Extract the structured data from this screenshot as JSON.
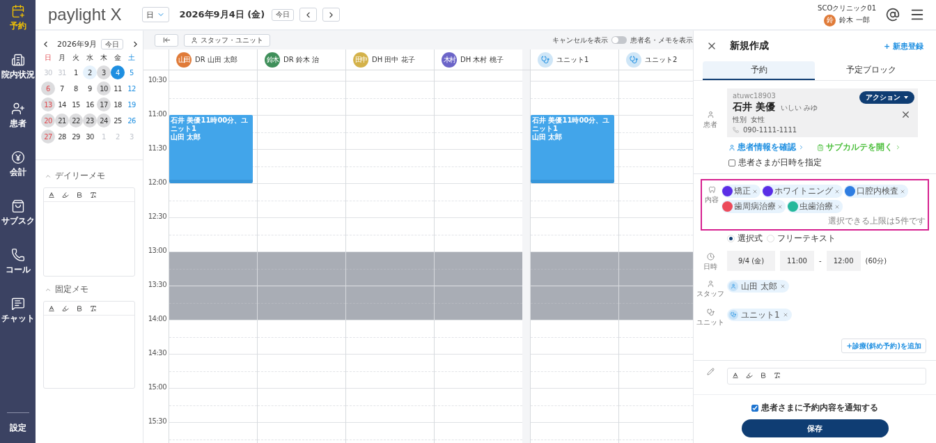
{
  "nav": {
    "items": [
      {
        "label": "予約",
        "selected": true
      },
      {
        "label": "院内状況",
        "selected": false
      },
      {
        "label": "患者",
        "selected": false
      },
      {
        "label": "会計",
        "selected": false
      },
      {
        "label": "サブスク",
        "selected": false
      },
      {
        "label": "コール",
        "selected": false
      },
      {
        "label": "チャット",
        "selected": false
      }
    ],
    "settings": "設定"
  },
  "header": {
    "logo": "paylight X",
    "view_select": "日",
    "date": "2026年9月4日 (金)",
    "today_button": "今日",
    "clinic": "SCOクリニック01",
    "user_initial": "鈴",
    "user_name": "鈴木 一郎"
  },
  "mini_calendar": {
    "title": "2026年9月",
    "today_button": "今日",
    "weekdays": [
      "日",
      "月",
      "火",
      "水",
      "木",
      "金",
      "土"
    ],
    "days": [
      {
        "label": "30",
        "muted": true,
        "marked": false,
        "today": false,
        "selected": false
      },
      {
        "label": "31",
        "muted": true,
        "marked": false,
        "today": false,
        "selected": false
      },
      {
        "label": "1",
        "muted": false,
        "marked": false,
        "today": false,
        "selected": false
      },
      {
        "label": "2",
        "muted": false,
        "marked": false,
        "today": true,
        "selected": false
      },
      {
        "label": "3",
        "muted": false,
        "marked": true,
        "today": false,
        "selected": false
      },
      {
        "label": "4",
        "muted": false,
        "marked": false,
        "today": false,
        "selected": true
      },
      {
        "label": "5",
        "muted": false,
        "marked": false,
        "today": false,
        "selected": false
      },
      {
        "label": "6",
        "muted": false,
        "marked": true,
        "today": false,
        "selected": false
      },
      {
        "label": "7",
        "muted": false,
        "marked": false,
        "today": false,
        "selected": false
      },
      {
        "label": "8",
        "muted": false,
        "marked": false,
        "today": false,
        "selected": false
      },
      {
        "label": "9",
        "muted": false,
        "marked": false,
        "today": false,
        "selected": false
      },
      {
        "label": "10",
        "muted": false,
        "marked": true,
        "today": false,
        "selected": false
      },
      {
        "label": "11",
        "muted": false,
        "marked": false,
        "today": false,
        "selected": false
      },
      {
        "label": "12",
        "muted": false,
        "marked": false,
        "today": false,
        "selected": false
      },
      {
        "label": "13",
        "muted": false,
        "marked": true,
        "today": false,
        "selected": false
      },
      {
        "label": "14",
        "muted": false,
        "marked": false,
        "today": false,
        "selected": false
      },
      {
        "label": "15",
        "muted": false,
        "marked": false,
        "today": false,
        "selected": false
      },
      {
        "label": "16",
        "muted": false,
        "marked": false,
        "today": false,
        "selected": false
      },
      {
        "label": "17",
        "muted": false,
        "marked": true,
        "today": false,
        "selected": false
      },
      {
        "label": "18",
        "muted": false,
        "marked": false,
        "today": false,
        "selected": false
      },
      {
        "label": "19",
        "muted": false,
        "marked": false,
        "today": false,
        "selected": false
      },
      {
        "label": "20",
        "muted": false,
        "marked": true,
        "today": false,
        "selected": false
      },
      {
        "label": "21",
        "muted": false,
        "marked": true,
        "today": false,
        "selected": false
      },
      {
        "label": "22",
        "muted": false,
        "marked": true,
        "today": false,
        "selected": false
      },
      {
        "label": "23",
        "muted": false,
        "marked": true,
        "today": false,
        "selected": false
      },
      {
        "label": "24",
        "muted": false,
        "marked": true,
        "today": false,
        "selected": false
      },
      {
        "label": "25",
        "muted": false,
        "marked": false,
        "today": false,
        "selected": false
      },
      {
        "label": "26",
        "muted": false,
        "marked": false,
        "today": false,
        "selected": false
      },
      {
        "label": "27",
        "muted": false,
        "marked": true,
        "today": false,
        "selected": false
      },
      {
        "label": "28",
        "muted": false,
        "marked": false,
        "today": false,
        "selected": false
      },
      {
        "label": "29",
        "muted": false,
        "marked": false,
        "today": false,
        "selected": false
      },
      {
        "label": "30",
        "muted": false,
        "marked": false,
        "today": false,
        "selected": false
      },
      {
        "label": "1",
        "muted": true,
        "marked": false,
        "today": false,
        "selected": false
      },
      {
        "label": "2",
        "muted": true,
        "marked": false,
        "today": false,
        "selected": false
      },
      {
        "label": "3",
        "muted": true,
        "marked": false,
        "today": false,
        "selected": false
      }
    ]
  },
  "memos": [
    {
      "title": "デイリーメモ",
      "expanded": true
    },
    {
      "title": "固定メモ",
      "expanded": true
    }
  ],
  "toolbar": {
    "staff_unit_button": "スタッフ・ユニット",
    "cancel_toggle": {
      "label": "キャンセルを表示",
      "on": false
    },
    "show_names_label": "患者名・メモを表示"
  },
  "calendar": {
    "columns": [
      {
        "kind": "staff",
        "name": "DR 山田 太郎",
        "initials": "山田",
        "color": "#e07b39"
      },
      {
        "kind": "staff",
        "name": "DR 鈴木 治",
        "initials": "鈴木",
        "color": "#3f8f5a"
      },
      {
        "kind": "staff",
        "name": "DH 田中 花子",
        "initials": "田中",
        "color": "#d4b24a"
      },
      {
        "kind": "staff",
        "name": "DH 木村 桃子",
        "initials": "木村",
        "color": "#6b64c8"
      },
      {
        "kind": "unit",
        "name": "ユニット1",
        "color": "#cfe6f7"
      },
      {
        "kind": "unit",
        "name": "ユニット2",
        "color": "#cfe6f7"
      }
    ],
    "rows": [
      {
        "time": "10:30",
        "cells": [
          {
            "kind": "free"
          },
          {
            "kind": "free"
          },
          {
            "kind": "free"
          },
          {
            "kind": "free"
          },
          {
            "kind": "free"
          },
          {
            "kind": "free"
          }
        ]
      },
      {
        "time": "11:00",
        "cells": [
          {
            "kind": "booked",
            "title": "石井 美優11時00分、ユニット1",
            "staff": "山田 太郎"
          },
          {
            "kind": "free"
          },
          {
            "kind": "free"
          },
          {
            "kind": "free"
          },
          {
            "kind": "booked",
            "title": "石井 美優11時00分、ユニット1",
            "staff": "山田 太郎"
          },
          {
            "kind": "free"
          }
        ]
      },
      {
        "time": "11:30",
        "cells": [
          {
            "kind": "booked"
          },
          {
            "kind": "free"
          },
          {
            "kind": "free"
          },
          {
            "kind": "free"
          },
          {
            "kind": "booked"
          },
          {
            "kind": "free"
          }
        ]
      },
      {
        "time": "12:00",
        "cells": [
          {
            "kind": "free"
          },
          {
            "kind": "free"
          },
          {
            "kind": "free"
          },
          {
            "kind": "free"
          },
          {
            "kind": "free"
          },
          {
            "kind": "free"
          }
        ]
      },
      {
        "time": "12:30",
        "cells": [
          {
            "kind": "free"
          },
          {
            "kind": "free"
          },
          {
            "kind": "free"
          },
          {
            "kind": "free"
          },
          {
            "kind": "free"
          },
          {
            "kind": "free"
          }
        ]
      },
      {
        "time": "13:00",
        "cells": [
          {
            "kind": "blocked"
          },
          {
            "kind": "blocked"
          },
          {
            "kind": "blocked"
          },
          {
            "kind": "blocked"
          },
          {
            "kind": "blocked"
          },
          {
            "kind": "blocked"
          }
        ]
      },
      {
        "time": "13:30",
        "cells": [
          {
            "kind": "blocked"
          },
          {
            "kind": "blocked"
          },
          {
            "kind": "blocked"
          },
          {
            "kind": "blocked"
          },
          {
            "kind": "blocked"
          },
          {
            "kind": "blocked"
          }
        ]
      },
      {
        "time": "14:00",
        "cells": [
          {
            "kind": "free"
          },
          {
            "kind": "free"
          },
          {
            "kind": "free"
          },
          {
            "kind": "free"
          },
          {
            "kind": "free"
          },
          {
            "kind": "free"
          }
        ]
      },
      {
        "time": "14:30",
        "cells": [
          {
            "kind": "free"
          },
          {
            "kind": "free"
          },
          {
            "kind": "free"
          },
          {
            "kind": "free"
          },
          {
            "kind": "free"
          },
          {
            "kind": "free"
          }
        ]
      },
      {
        "time": "15:00",
        "cells": [
          {
            "kind": "free"
          },
          {
            "kind": "free"
          },
          {
            "kind": "free"
          },
          {
            "kind": "free"
          },
          {
            "kind": "free"
          },
          {
            "kind": "free"
          }
        ]
      },
      {
        "time": "15:30",
        "cells": [
          {
            "kind": "free"
          },
          {
            "kind": "free"
          },
          {
            "kind": "free"
          },
          {
            "kind": "free"
          },
          {
            "kind": "free"
          },
          {
            "kind": "free"
          }
        ]
      }
    ]
  },
  "panel": {
    "title": "新規作成",
    "new_patient_link": "+ 新患登録",
    "tabs": [
      {
        "label": "予約",
        "selected": true
      },
      {
        "label": "予定ブロック",
        "selected": false
      }
    ],
    "patient": {
      "label": "患者",
      "id": "atuwc18903",
      "name": "石井 美優",
      "kana": "いしい みゆ",
      "gender_label": "性別",
      "gender": "女性",
      "phone": "090-1111-1111",
      "action_button": "アクション"
    },
    "links": [
      "患者情報を確認",
      "サブカルテを開く"
    ],
    "patient_sets_time": {
      "label": "患者さまが日時を指定",
      "checked": false
    },
    "content": {
      "label": "内容",
      "highlighted": true,
      "tags": [
        {
          "label": "矯正",
          "color": "#5a2ee6"
        },
        {
          "label": "ホワイトニング",
          "color": "#5a2ee6"
        },
        {
          "label": "口腔内検査",
          "color": "#2f7de1"
        },
        {
          "label": "歯周病治療",
          "color": "#ec4a5a"
        },
        {
          "label": "虫歯治療",
          "color": "#25b89c"
        }
      ],
      "note": "選択できる上限は5件です"
    },
    "input_modes": [
      {
        "label": "選択式",
        "selected": true
      },
      {
        "label": "フリーテキスト",
        "selected": false
      }
    ],
    "datetime": {
      "label": "日時",
      "date": "9/4 (金)",
      "start": "11:00",
      "separator": "-",
      "end": "12:00",
      "duration": "(60分)"
    },
    "staff": {
      "label": "スタッフ",
      "chips": [
        "山田 太郎"
      ]
    },
    "unit": {
      "label": "ユニット",
      "chips": [
        "ユニット1"
      ]
    },
    "add_button": "+診療(斜め予約)を追加",
    "notify": {
      "label": "患者さまに予約内容を通知する",
      "checked": true
    },
    "save_button": "保存"
  }
}
